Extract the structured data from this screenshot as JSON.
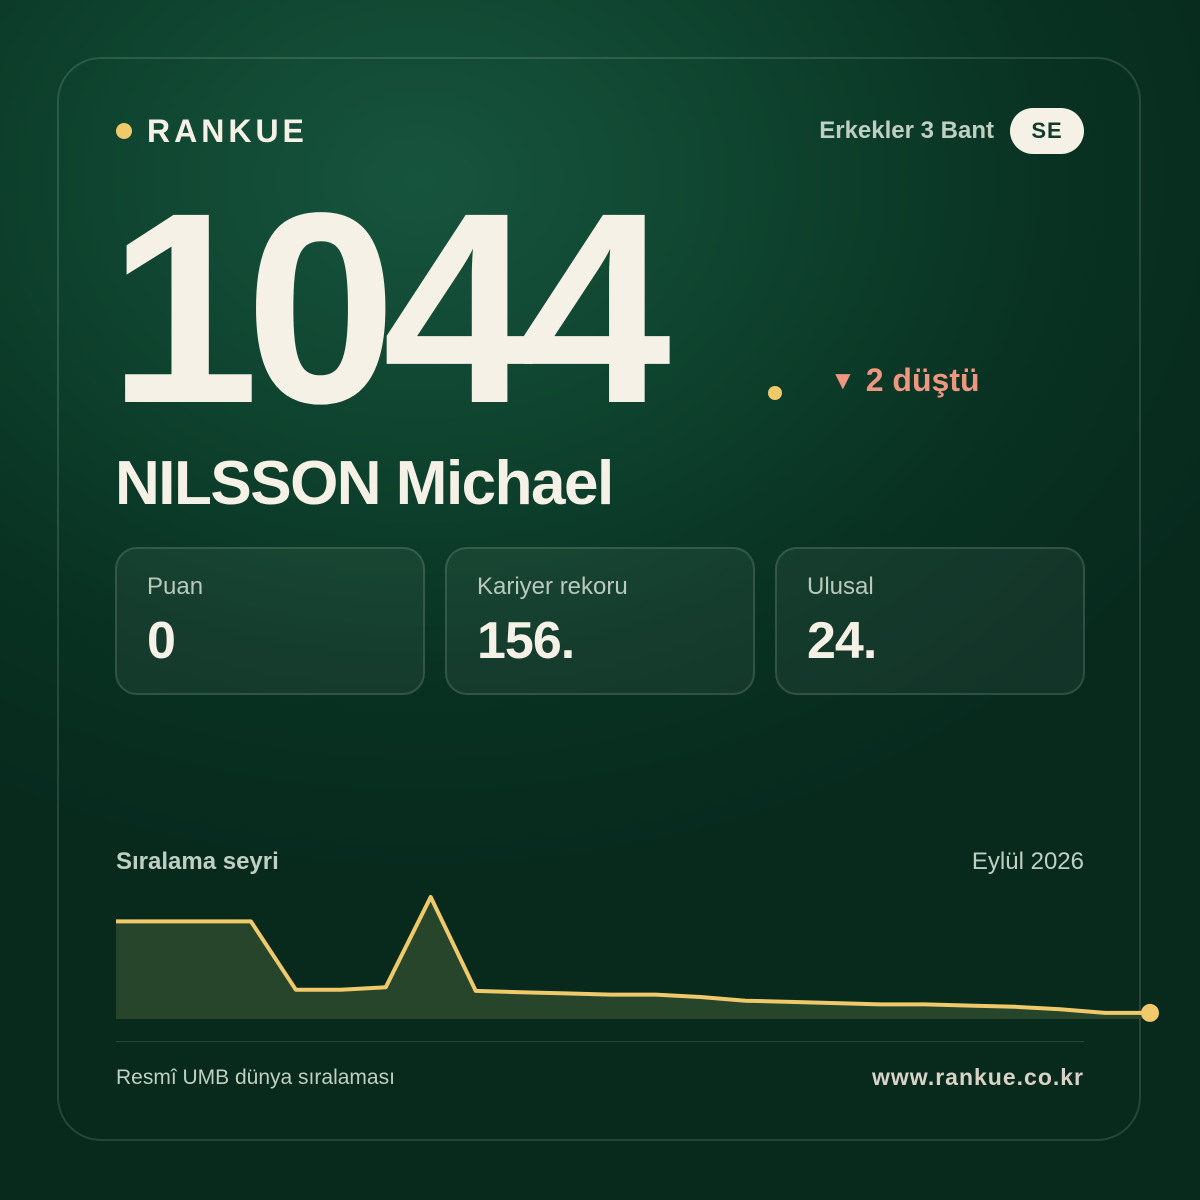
{
  "colors": {
    "accent": "#f0c96a",
    "down": "#ef9680",
    "text": "#f6f1e6",
    "muted": "#bfcfc2",
    "area_fill": "#2b4a2e"
  },
  "brand": {
    "name": "RANKUE",
    "dot_icon": "brand-dot"
  },
  "category": "Erkekler 3 Bant",
  "country_code": "SE",
  "rank": "1044",
  "change": {
    "icon": "triangle-down-icon",
    "text": "2 düştü"
  },
  "player_name": "NILSSON Michael",
  "stats": [
    {
      "label": "Puan",
      "value": "0"
    },
    {
      "label": "Kariyer rekoru",
      "value": "156."
    },
    {
      "label": "Ulusal",
      "value": "24."
    }
  ],
  "trend": {
    "title": "Sıralama seyri",
    "date": "Eylül 2026"
  },
  "chart_data": {
    "type": "area",
    "title": "Sıralama seyri",
    "xlabel": "",
    "ylabel": "",
    "grid": false,
    "legend": "none",
    "series": [
      {
        "values": [
          8,
          8,
          8,
          8,
          2.4,
          2.4,
          2.6,
          10,
          2.3,
          2.2,
          2.1,
          2.0,
          2.0,
          1.8,
          1.5,
          1.4,
          1.3,
          1.2,
          1.2,
          1.1,
          1.0,
          0.8,
          0.5,
          0.5
        ]
      }
    ],
    "ylim": [
      0,
      10
    ]
  },
  "footer": {
    "source": "Resmî UMB dünya sıralaması",
    "url": "www.rankue.co.kr"
  }
}
